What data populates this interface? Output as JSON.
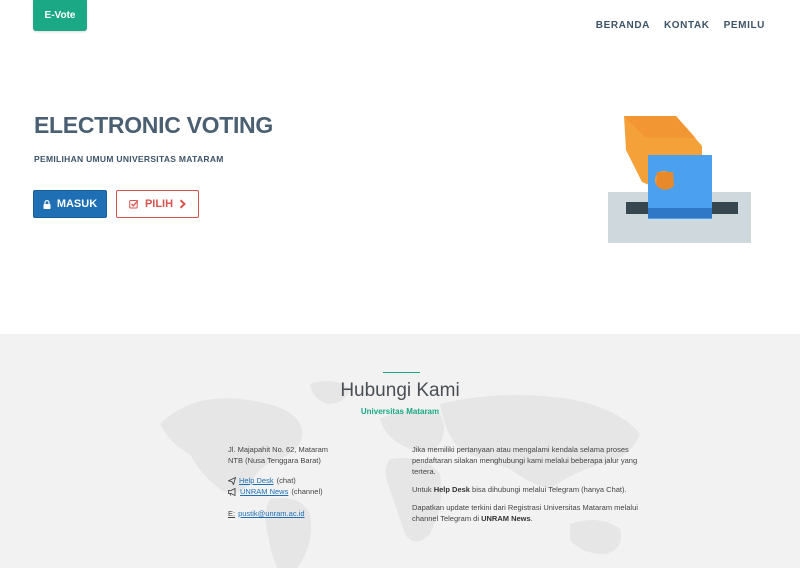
{
  "header": {
    "logo": "E-Vote",
    "nav": [
      "BERANDA",
      "KONTAK",
      "PEMILU"
    ]
  },
  "hero": {
    "title": "ELECTRONIC VOTING",
    "subtitle": "PEMILIHAN UMUM UNIVERSITAS MATARAM",
    "btn_masuk": "MASUK",
    "btn_pilih": "PILIH"
  },
  "contact": {
    "title": "Hubungi Kami",
    "subtitle": "Universitas Mataram",
    "address_line1": "Jl. Majapahit No. 62, Mataram",
    "address_line2": "NTB (Nusa Tenggara Barat)",
    "helpdesk_link": "Help Desk",
    "helpdesk_suffix": "(chat)",
    "news_link": "UNRAM News",
    "news_suffix": "(channel)",
    "email_key": "E:",
    "email": "pustik@unram.ac.id",
    "para1": "Jika memiliki pertanyaan atau mengalami kendala selama proses pendaftaran silakan menghubungi kami melalui beberapa jalur yang tertera.",
    "para2_a": "Untuk ",
    "para2_b": "Help Desk",
    "para2_c": " bisa dihubungi melalui Telegram (hanya Chat).",
    "para3_a": "Dapatkan update terkini dari Registrasi Universitas Mataram melalui channel Telegram di ",
    "para3_b": "UNRAM News",
    "para3_c": "."
  },
  "colors": {
    "brand": "#1aa984",
    "primary": "#1e6fb4",
    "danger": "#d9534f"
  }
}
